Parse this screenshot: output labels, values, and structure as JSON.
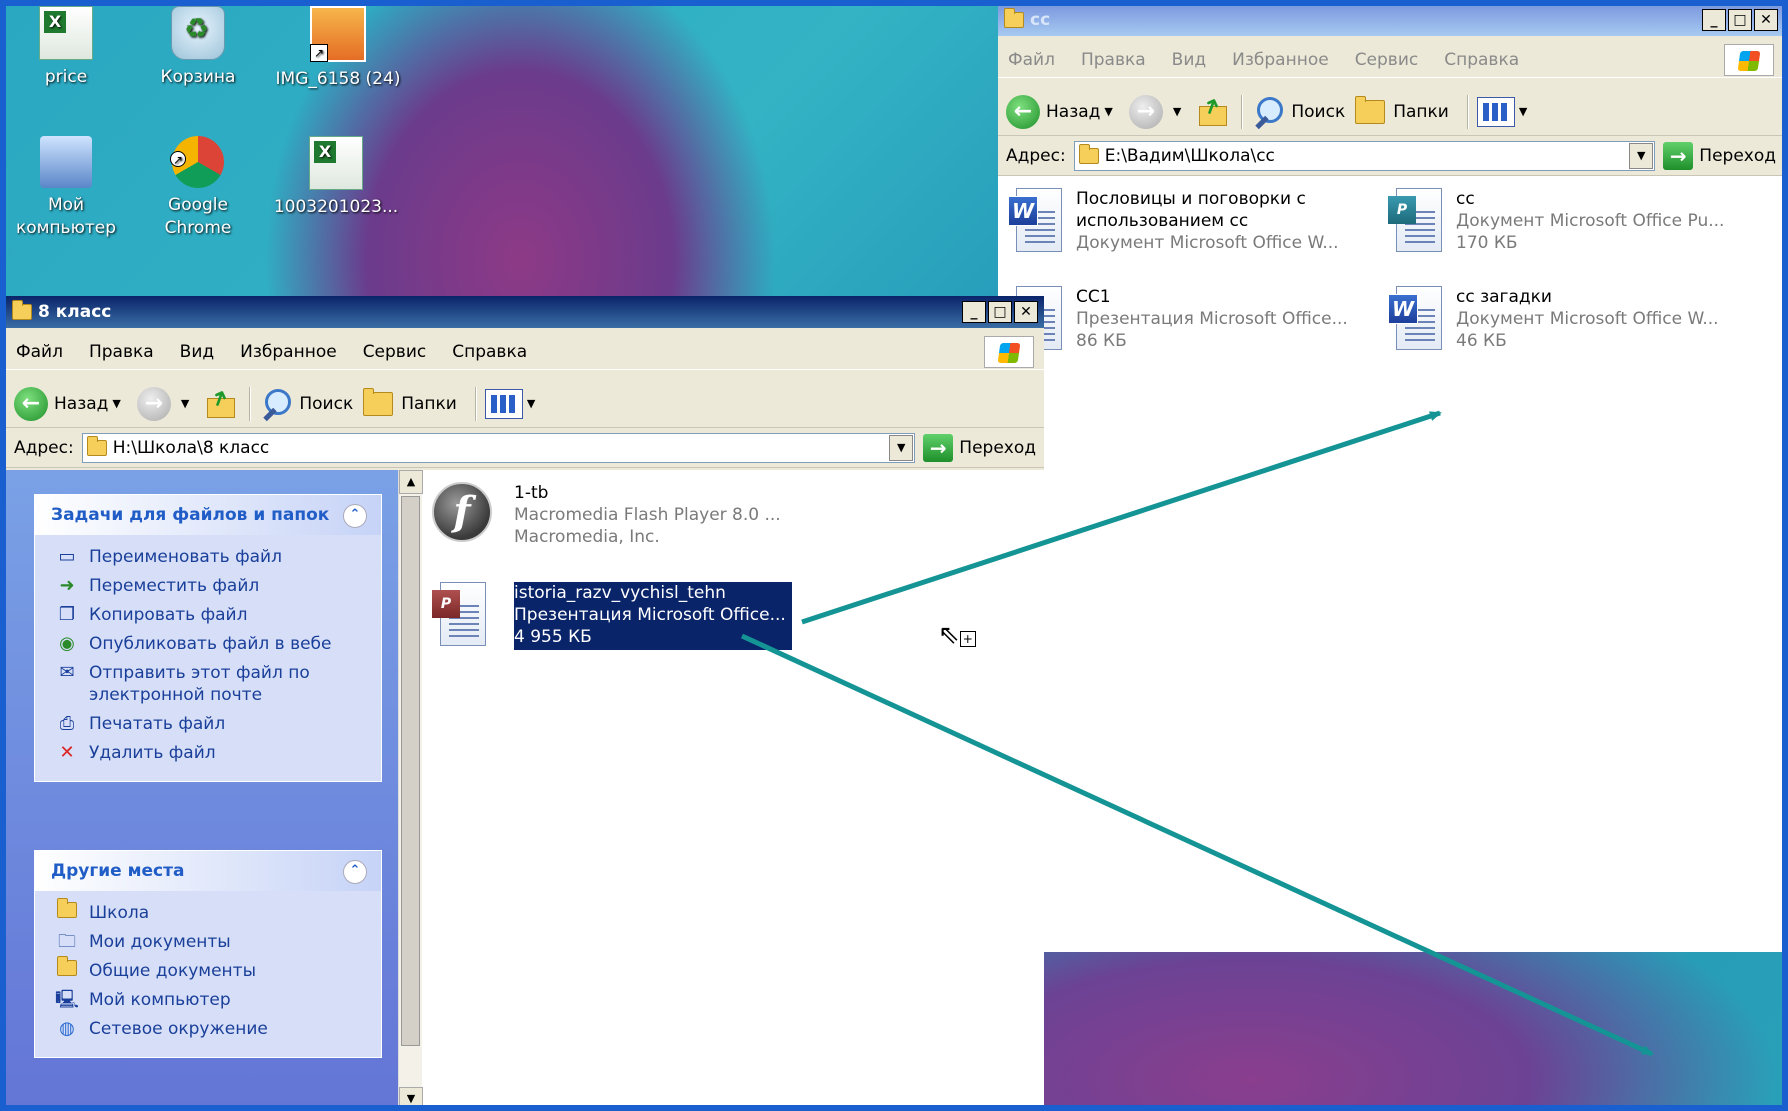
{
  "desktop": {
    "icons": [
      {
        "label": "price"
      },
      {
        "label": "Корзина"
      },
      {
        "label": "IMG_6158 (24)"
      },
      {
        "label": "Мой компьютер"
      },
      {
        "label": "Google Chrome"
      },
      {
        "label": "1003201023..."
      }
    ]
  },
  "win_cc": {
    "title": "cc",
    "menu": [
      "Файл",
      "Правка",
      "Вид",
      "Избранное",
      "Сервис",
      "Справка"
    ],
    "toolbar": {
      "back": "Назад",
      "search": "Поиск",
      "folders": "Папки"
    },
    "address": {
      "label": "Адрес:",
      "value": "E:\\Вадим\\Школа\\cc",
      "go": "Переход"
    },
    "files": [
      {
        "name1": "Пословицы и поговорки с",
        "name2": "использованием cc",
        "type": "Документ Microsoft Office W...",
        "size": "",
        "icon": "word"
      },
      {
        "name1": "cc",
        "name2": "",
        "type": "Документ Microsoft Office Pu...",
        "size": "170 КБ",
        "icon": "publisher"
      },
      {
        "name1": "CC1",
        "name2": "",
        "type": "Презентация Microsoft Office...",
        "size": "86 КБ",
        "icon": "powerpoint"
      },
      {
        "name1": "cc загадки",
        "name2": "",
        "type": "Документ Microsoft Office W...",
        "size": "46 КБ",
        "icon": "word"
      }
    ]
  },
  "win_8": {
    "title": "8 класс",
    "menu": [
      "Файл",
      "Правка",
      "Вид",
      "Избранное",
      "Сервис",
      "Справка"
    ],
    "toolbar": {
      "back": "Назад",
      "search": "Поиск",
      "folders": "Папки"
    },
    "address": {
      "label": "Адрес:",
      "value": "H:\\Школа\\8 класс",
      "go": "Переход"
    },
    "tasks": {
      "title": "Задачи для файлов и папок",
      "items": [
        "Переименовать файл",
        "Переместить файл",
        "Копировать файл",
        "Опубликовать файл в вебе",
        "Отправить этот файл по",
        "электронной почте",
        "Печатать файл",
        "Удалить файл"
      ]
    },
    "places": {
      "title": "Другие места",
      "items": [
        "Школа",
        "Мои документы",
        "Общие документы",
        "Мой компьютер",
        "Сетевое окружение"
      ]
    },
    "files": [
      {
        "name": "1-tb",
        "type": "Macromedia Flash Player 8.0 ...",
        "vendor": "Macromedia, Inc."
      },
      {
        "name": "istoria_razv_vychisl_tehn",
        "type": "Презентация Microsoft Office...",
        "size": "4 955 КБ"
      }
    ]
  },
  "colors": {
    "arrow": "#149494",
    "selection": "#0a246a"
  }
}
